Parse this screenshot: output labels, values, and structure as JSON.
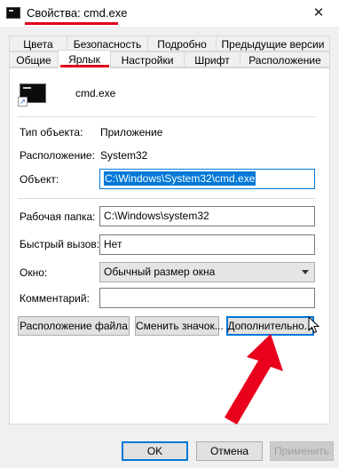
{
  "window": {
    "title": "Свойства: cmd.exe",
    "close_glyph": "✕"
  },
  "tabs": {
    "row_back": [
      "Цвета",
      "Безопасность",
      "Подробно",
      "Предыдущие версии"
    ],
    "row_front": [
      "Общие",
      "Ярлык",
      "Настройки",
      "Шрифт",
      "Расположение"
    ],
    "selected": "Ярлык"
  },
  "shortcut": {
    "file_name": "cmd.exe",
    "icon": "cmd-icon",
    "type_label": "Тип объекта:",
    "type_value": "Приложение",
    "location_label": "Расположение:",
    "location_value": "System32",
    "target_label": "Объект:",
    "target_value": "C:\\Windows\\System32\\cmd.exe",
    "workdir_label": "Рабочая папка:",
    "workdir_value": "C:\\Windows\\system32",
    "hotkey_label": "Быстрый вызов:",
    "hotkey_value": "Нет",
    "window_label": "Окно:",
    "window_value": "Обычный размер окна",
    "comment_label": "Комментарий:",
    "comment_value": ""
  },
  "buttons": {
    "open_location": "Расположение файла",
    "change_icon": "Сменить значок...",
    "advanced": "Дополнительно...",
    "ok": "OK",
    "cancel": "Отмена",
    "apply": "Применить"
  },
  "annotations": {
    "highlight_color": "#e0001a",
    "arrow": "red-arrow-icon"
  }
}
